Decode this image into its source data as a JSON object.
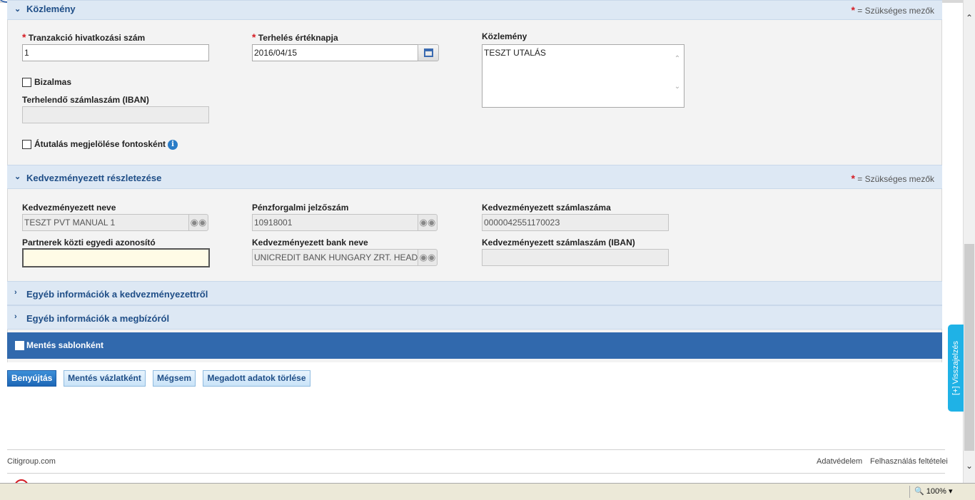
{
  "section1": {
    "title": "Közlemény",
    "required_note": "= Szükséges mezők",
    "required_star": "*"
  },
  "form1": {
    "ref_label": "Tranzakció hivatkozási szám",
    "ref_value": "1",
    "date_label": "Terhelés értéknapja",
    "date_value": "2016/04/15",
    "memo_label": "Közlemény",
    "memo_value": "TESZT UTALÁS",
    "confidential_label": "Bizalmas",
    "iban_label": "Terhelendő számlaszám (IBAN)",
    "iban_value": "",
    "important_label": "Átutalás megjelölése fontosként",
    "info_glyph": "i"
  },
  "section2": {
    "title": "Kedvezményezett részletezése",
    "required_note": "= Szükséges mezők",
    "required_star": "*"
  },
  "form2": {
    "bene_name_label": "Kedvezményezett neve",
    "bene_name_value": "TESZT PVT MANUAL 1",
    "clearing_label": "Pénzforgalmi jelzőszám",
    "clearing_value": "10918001",
    "account_label": "Kedvezményezett számlaszáma",
    "account_value": "000004255117002З",
    "partner_id_label": "Partnerek közti egyedi azonosító",
    "partner_id_value": "",
    "bank_label": "Kedvezményezett bank neve",
    "bank_value": "UNICREDIT BANK HUNGARY ZRT. HEAD",
    "bene_iban_label": "Kedvezményezett számlaszám (IBAN)",
    "bene_iban_value": ""
  },
  "collapsed": [
    {
      "title": "Egyéb információk a kedvezményezettről"
    },
    {
      "title": "Egyéb információk a megbízóról"
    }
  ],
  "save_template_label": "Mentés sablonként",
  "buttons": {
    "submit": "Benyújtás",
    "draft": "Mentés vázlatként",
    "cancel": "Mégsem",
    "clear": "Megadott adatok törlése"
  },
  "footer": {
    "left": "Citigroup.com",
    "privacy": "Adatvédelem",
    "terms": "Felhasználás feltételei"
  },
  "feedback_tab": "[+] Visszajelzés",
  "zoom": "100%",
  "icons": {
    "expanded": "chevron-down",
    "collapsed": "chevron-right",
    "lookup": "binoculars",
    "calendar": "calendar"
  },
  "colors": {
    "accent": "#3169ad",
    "header": "#dde8f4",
    "required": "#d51d24",
    "feedback": "#1fb2e6"
  }
}
